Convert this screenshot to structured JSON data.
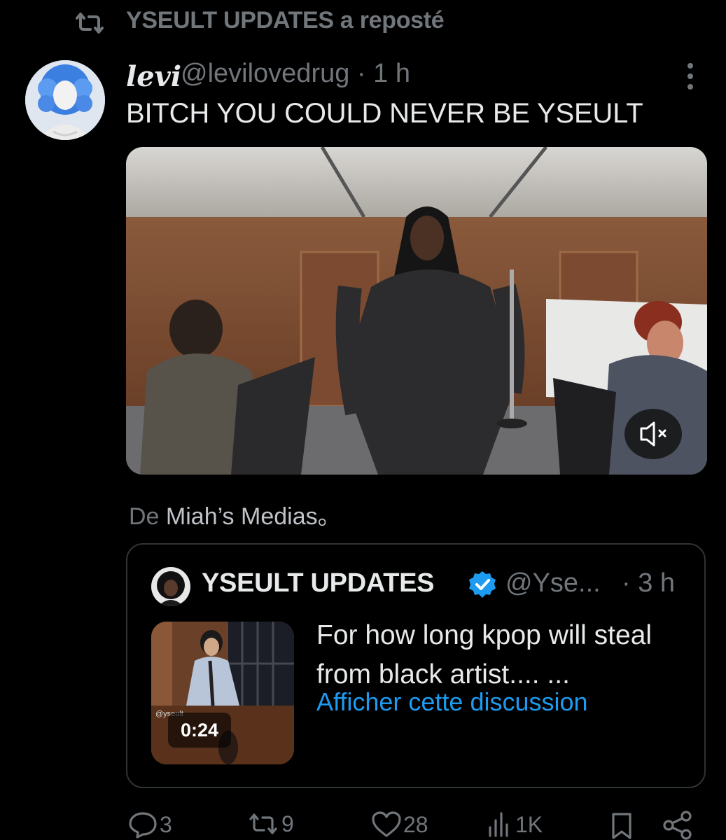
{
  "repost": {
    "text": "YSEULT UPDATES a reposté",
    "icon": "repost-icon"
  },
  "tweet": {
    "author_name": "levi",
    "handle_time": "@levilovedrug · 1 h",
    "text": "BITCH YOU COULD NEVER BE YSEULT",
    "media": {
      "type": "video",
      "muted": true
    },
    "attribution_prefix": "De",
    "attribution_source": "Miah’s Medias。"
  },
  "quote": {
    "name": "YSEULT UPDATES",
    "handle": "@Yse...",
    "time": "· 3 h",
    "text": "For how long kpop will steal from black artist.... ...",
    "link": "Afficher cette discussion",
    "thumb_duration": "0:24",
    "thumb_watermark": "@yseult"
  },
  "actions": {
    "replies": "3",
    "reposts": "9",
    "likes": "28",
    "views": "1K"
  },
  "colors": {
    "accent": "#1d9bf0",
    "muted": "#71767b",
    "text": "#e7e9ea",
    "bg": "#000000"
  }
}
